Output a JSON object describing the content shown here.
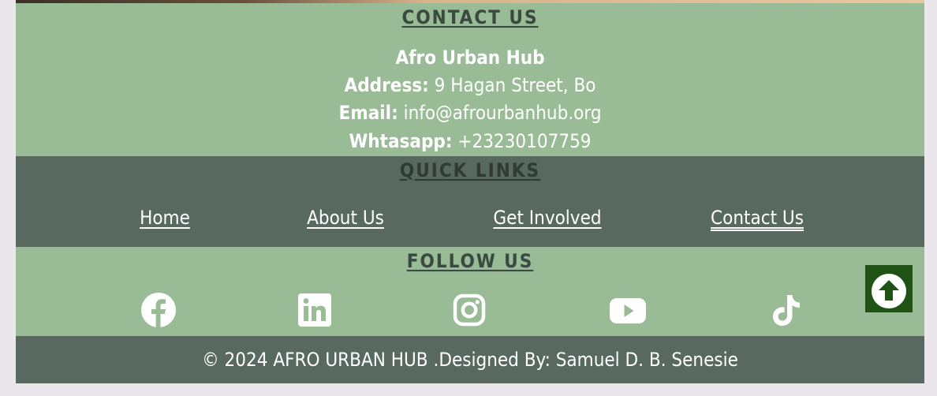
{
  "contact": {
    "title": "CONTACT US",
    "org_name": "Afro Urban Hub",
    "address_label": "Address:",
    "address_value": " 9 Hagan Street, Bo",
    "email_label": "Email:",
    "email_value": " info@afrourbanhub.org",
    "whatsapp_label": "Whtasapp:",
    "whatsapp_value": " +23230107759"
  },
  "quick_links": {
    "title": "QUICK LINKS",
    "items": [
      {
        "label": "Home"
      },
      {
        "label": "About Us"
      },
      {
        "label": "Get Involved"
      },
      {
        "label": "Contact Us"
      }
    ]
  },
  "follow": {
    "title": "FOLLOW US",
    "icons": [
      "facebook-icon",
      "linkedin-icon",
      "instagram-icon",
      "youtube-icon",
      "tiktok-icon"
    ]
  },
  "footer": {
    "copyright": "© 2024 AFRO URBAN HUB .Designed By: Samuel D. B. Senesie"
  },
  "colors": {
    "contact_bg": "#99bb96",
    "links_bg": "#58695f",
    "scroll_top_bg": "#1f5316",
    "page_bg": "#ebe5ec"
  }
}
